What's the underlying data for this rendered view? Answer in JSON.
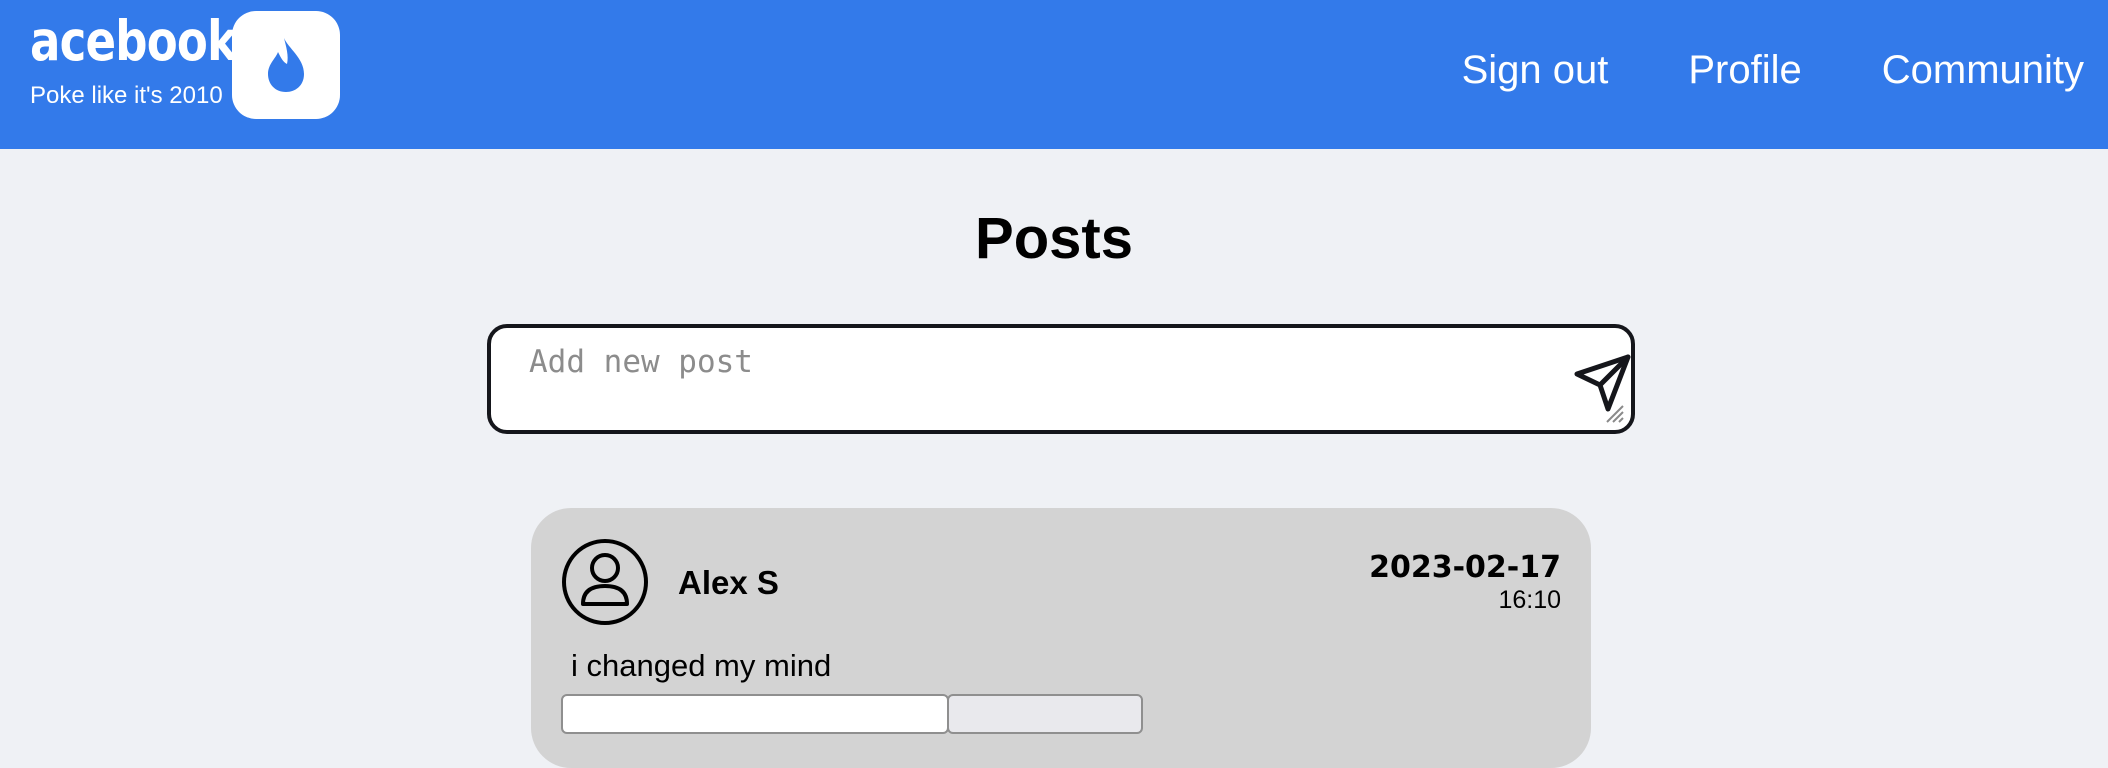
{
  "header": {
    "brand_name": "acebook",
    "tagline": "Poke like it's 2010",
    "logo_icon": "flame-icon",
    "background": "#337aea",
    "nav": [
      {
        "label": "Sign out"
      },
      {
        "label": "Profile"
      },
      {
        "label": "Community"
      }
    ]
  },
  "main": {
    "title": "Posts",
    "new_post": {
      "placeholder": "Add new post",
      "value": "",
      "send_icon": "paper-plane-icon"
    },
    "posts": [
      {
        "author": "Alex S",
        "avatar_icon": "user-circle-icon",
        "date": "2023-02-17",
        "time": "16:10",
        "body": "i changed my mind",
        "comment_value": "",
        "comment_button_label": ""
      }
    ]
  }
}
